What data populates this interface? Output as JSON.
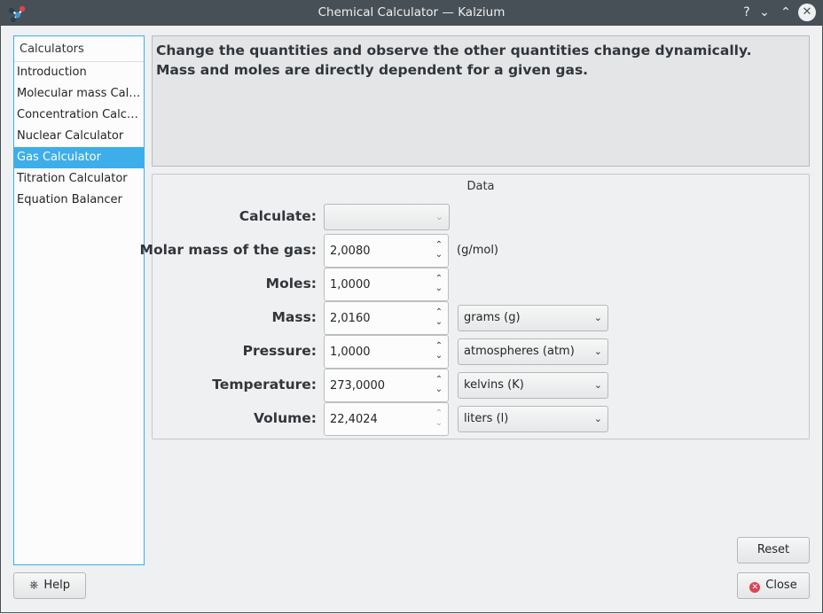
{
  "window": {
    "title": "Chemical Calculator — Kalzium",
    "controls": {
      "help": "?",
      "minimize": "⌄",
      "maximize": "⌃",
      "close": "✕"
    }
  },
  "sidebar": {
    "header": "Calculators",
    "items": [
      {
        "label": "Introduction"
      },
      {
        "label": "Molecular mass Calc..."
      },
      {
        "label": "Concentration Calcul..."
      },
      {
        "label": "Nuclear Calculator"
      },
      {
        "label": "Gas Calculator",
        "selected": true
      },
      {
        "label": "Titration Calculator"
      },
      {
        "label": "Equation Balancer"
      }
    ]
  },
  "info": {
    "line1": "Change the quantities and observe the other quantities change dynamically.",
    "line2": "Mass and moles are directly dependent for a given gas."
  },
  "data_group": {
    "title": "Data",
    "calculate": {
      "label": "Calculate:",
      "value": ""
    },
    "molar_mass": {
      "label": "Molar mass of the gas:",
      "value": "2,0080",
      "unit": "(g/mol)"
    },
    "moles": {
      "label": "Moles:",
      "value": "1,0000"
    },
    "mass": {
      "label": "Mass:",
      "value": "2,0160",
      "unit": "grams (g)"
    },
    "pressure": {
      "label": "Pressure:",
      "value": "1,0000",
      "unit": "atmospheres (atm)"
    },
    "temperature": {
      "label": "Temperature:",
      "value": "273,0000",
      "unit": "kelvins (K)"
    },
    "volume": {
      "label": "Volume:",
      "value": "22,4024",
      "unit": "liters (l)"
    }
  },
  "buttons": {
    "reset": "Reset",
    "help": "Help",
    "close": "Close"
  },
  "colors": {
    "selection": "#3daee9",
    "titlebar": "#475057",
    "close_icon": "#da4453"
  }
}
